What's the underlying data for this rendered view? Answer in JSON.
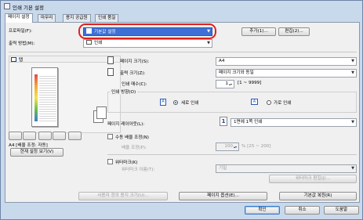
{
  "window": {
    "title": "인쇄 기본 설정"
  },
  "tabs": [
    "페이지 설정",
    "마무리",
    "용지 공급원",
    "인쇄 품질"
  ],
  "profile": {
    "label": "프로파일(F):",
    "value": "기본값 설정",
    "add": "추가(1)...",
    "edit": "편집(2)..."
  },
  "output": {
    "label": "출력 방법(M):",
    "value": "인쇄"
  },
  "preview": {
    "tab_label": "탭",
    "caption": "A4 [배율 조정: 자동]",
    "view_button": "현재 설정 보기(V)"
  },
  "page_size": {
    "label": "페이지 크기(S):",
    "value": "A4"
  },
  "output_size": {
    "label": "출력 크기(Z):",
    "value": "페이지 크기와 동일"
  },
  "copies": {
    "label": "인쇄 매수(C):",
    "value": "1",
    "range": "[1 ~ 9999]"
  },
  "orientation": {
    "label": "인쇄 방향(O)",
    "portrait": "세로 인쇄",
    "landscape": "가로 인쇄",
    "selected": "portrait"
  },
  "layout": {
    "label": "페이지 레이아웃(L):",
    "number": "1",
    "value": "1면에 1쪽 인쇄"
  },
  "manual_scale": {
    "label": "수동 배율 조정(N)",
    "scale_label": "배율 조정(P):",
    "scale_value": "100",
    "range": "% [25 ~ 200]"
  },
  "watermark": {
    "label": "워터마크(K)",
    "name_label": "워터마크 이름(T):",
    "name_value": "기밀",
    "edit": "워터마크 편집(J)..."
  },
  "bottom_buttons": {
    "user_paper": "사용자 정의 용지 크기(U)...",
    "page_options": "페이지 옵션(E)...",
    "restore": "기본값 복원(R)"
  },
  "dialog": {
    "ok": "확인",
    "cancel": "취소",
    "help": "도움말"
  },
  "colors": {
    "highlight": "#3d6fd6",
    "red_mark": "#e02020"
  }
}
